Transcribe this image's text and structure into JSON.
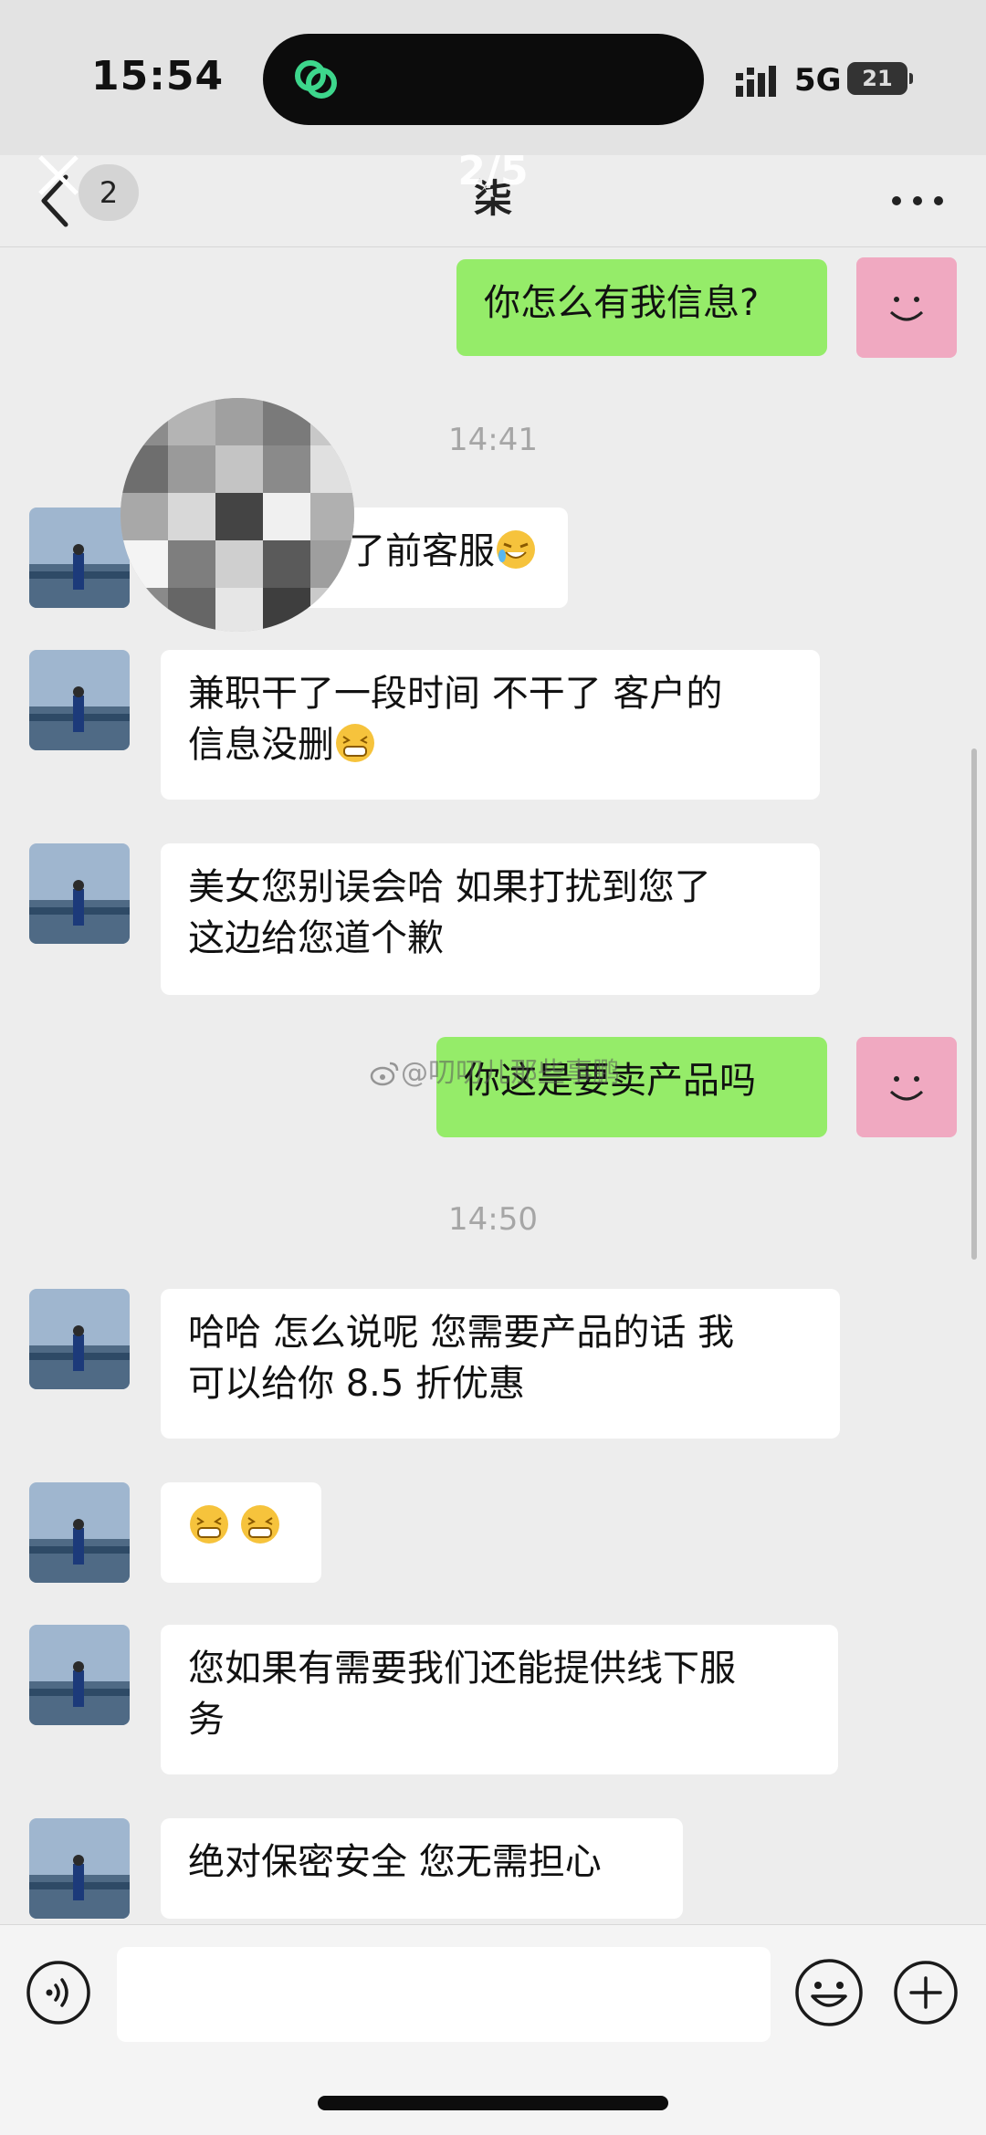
{
  "status_bar": {
    "time": "15:54",
    "network": "5G",
    "battery": "21"
  },
  "header": {
    "unread_count": "2",
    "title": "柒",
    "page_indicator": "2/5"
  },
  "watermark": "@叨叨儿那些事鹏",
  "messages": [
    {
      "type": "out",
      "text": "你怎么有我信息?"
    },
    {
      "type": "time",
      "text": "14:41"
    },
    {
      "type": "in",
      "text": "我之前客服",
      "visible_text": "了前客服",
      "emoji": "cry-laugh"
    },
    {
      "type": "in",
      "text": "兼职干了一段时间 不干了 客户的信息没删",
      "lines": [
        "兼职干了一段时间 不干了 客户的",
        "信息没删"
      ],
      "emoji": "grin"
    },
    {
      "type": "in",
      "lines": [
        "美女您别误会哈 如果打扰到您了",
        "这边给您道个歉"
      ]
    },
    {
      "type": "out",
      "text": "你这是要卖产品吗"
    },
    {
      "type": "time",
      "text": "14:50"
    },
    {
      "type": "in",
      "lines": [
        "哈哈  怎么说呢 您需要产品的话 我",
        "可以给你 8.5 折优惠"
      ]
    },
    {
      "type": "in",
      "emoji": "grin grin"
    },
    {
      "type": "in",
      "lines": [
        "您如果有需要我们还能提供线下服",
        "务"
      ]
    },
    {
      "type": "in",
      "text": "绝对保密安全 您无需担心"
    }
  ],
  "input": {
    "placeholder": ""
  },
  "colors": {
    "outgoing_bubble": "#95ec69",
    "incoming_bubble": "#ffffff",
    "self_avatar": "#f0a9c1",
    "background": "#ededed"
  }
}
